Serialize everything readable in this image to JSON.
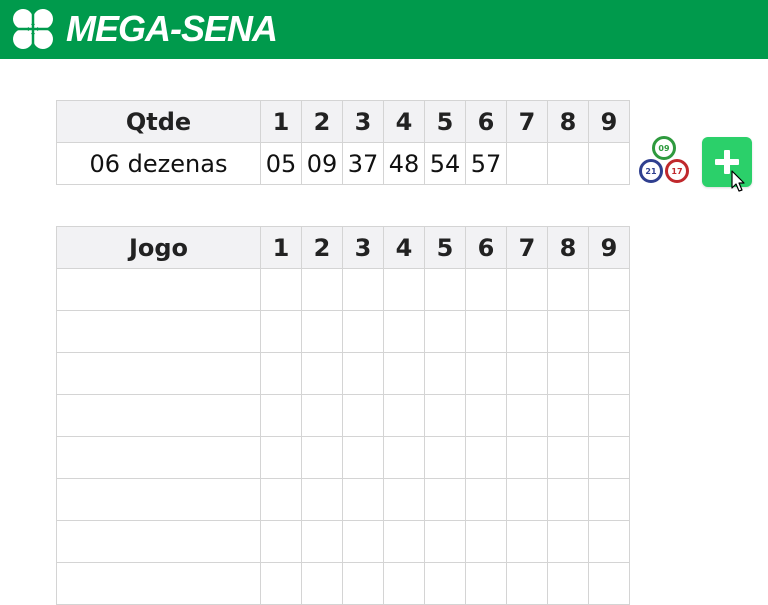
{
  "header": {
    "brand_label": "MEGA-SENA",
    "bg_color": "#009a4c",
    "logo_icon": "clover-icon"
  },
  "qtde_table": {
    "header_label": "Qtde",
    "columns": [
      "1",
      "2",
      "3",
      "4",
      "5",
      "6",
      "7",
      "8",
      "9"
    ],
    "row": {
      "qtde": "06 dezenas",
      "numbers": [
        "05",
        "09",
        "37",
        "48",
        "54",
        "57",
        "",
        "",
        ""
      ]
    }
  },
  "jogo_table": {
    "header_label": "Jogo",
    "columns": [
      "1",
      "2",
      "3",
      "4",
      "5",
      "6",
      "7",
      "8",
      "9"
    ],
    "empty_rows": 8
  },
  "balls_icon": {
    "icon": "lottery-balls-icon",
    "numbers": [
      "09",
      "21",
      "17"
    ],
    "colors": [
      "#2e9a3e",
      "#2f3f8f",
      "#c0282c"
    ]
  },
  "add_button": {
    "icon": "plus-icon",
    "color": "#2bd06a"
  },
  "cursor": {
    "icon": "mouse-cursor-icon"
  }
}
